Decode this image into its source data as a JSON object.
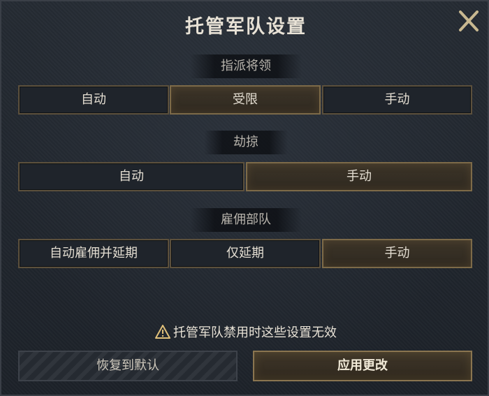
{
  "dialog": {
    "title": "托管军队设置",
    "close_icon": "close-icon"
  },
  "sections": {
    "general": {
      "label": "指派将领",
      "options": [
        "自动",
        "受限",
        "手动"
      ],
      "selected": "受限"
    },
    "raid": {
      "label": "劫掠",
      "options": [
        "自动",
        "手动"
      ],
      "selected": "手动"
    },
    "recruit": {
      "label": "雇佣部队",
      "options": [
        "自动雇佣并延期",
        "仅延期",
        "手动"
      ],
      "selected": "手动"
    }
  },
  "footer": {
    "warning_icon": "warning-icon",
    "warning_text": "托管军队禁用时这些设置无效",
    "reset_label": "恢复到默认",
    "apply_label": "应用更改"
  },
  "colors": {
    "accent_gold": "#d8b26a",
    "selected_bg": "#3c3428",
    "panel_bg": "#1f242b"
  }
}
